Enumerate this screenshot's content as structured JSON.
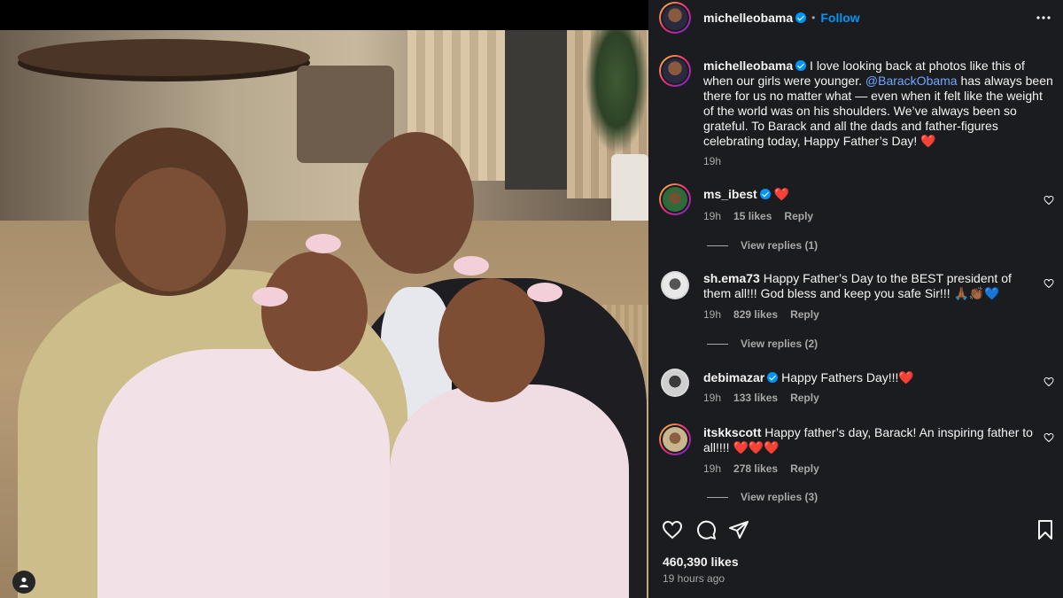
{
  "post": {
    "author": "michelleobama",
    "follow_label": "Follow",
    "separator": "•",
    "caption_lines": [
      "I love looking back at photos like this of",
      "when our girls were younger.",
      "has always been",
      "there for us no matter what — even when it felt like the weight",
      "of the world was on his shoulders. We’ve always been so",
      "grateful. To Barack and all the dads and father-figures",
      "celebrating today, Happy Father’s Day!"
    ],
    "mention": "@BarackObama",
    "caption_emoji": "❤️",
    "caption_age": "19h",
    "likes": "460,390 likes",
    "posted_ago": "19 hours ago"
  },
  "comments": [
    {
      "username": "ms_ibest",
      "verified": true,
      "text": "❤️",
      "age": "19h",
      "likes": "15 likes",
      "reply": "Reply",
      "view_replies": "View replies (1)"
    },
    {
      "username": "sh.ema73",
      "verified": false,
      "text_line1": "Happy Father’s Day to the BEST president of",
      "text_line2": "them all!!! God bless and keep you safe Sir!!! 🙏🏾👏🏾💙",
      "age": "19h",
      "likes": "829 likes",
      "reply": "Reply",
      "view_replies": "View replies (2)"
    },
    {
      "username": "debimazar",
      "verified": true,
      "text": "Happy Fathers Day!!!❤️",
      "age": "19h",
      "likes": "133 likes",
      "reply": "Reply"
    },
    {
      "username": "itskkscott",
      "verified": false,
      "text_line1": "Happy father’s day, Barack! An inspiring father to",
      "text_line2": "all!!!! ❤️❤️❤️",
      "age": "19h",
      "likes": "278 likes",
      "reply": "Reply",
      "view_replies": "View replies (3)"
    }
  ],
  "icons": {
    "more": "more-options-icon",
    "like": "heart-icon",
    "comment": "comment-icon",
    "share": "share-icon",
    "save": "bookmark-icon",
    "tags": "user-tag-icon"
  },
  "colors": {
    "panel_bg": "#1b1c20",
    "verified": "#0095f6",
    "mention": "#6ea8fe",
    "follow": "#0095f6",
    "heart": "#ff3040"
  }
}
